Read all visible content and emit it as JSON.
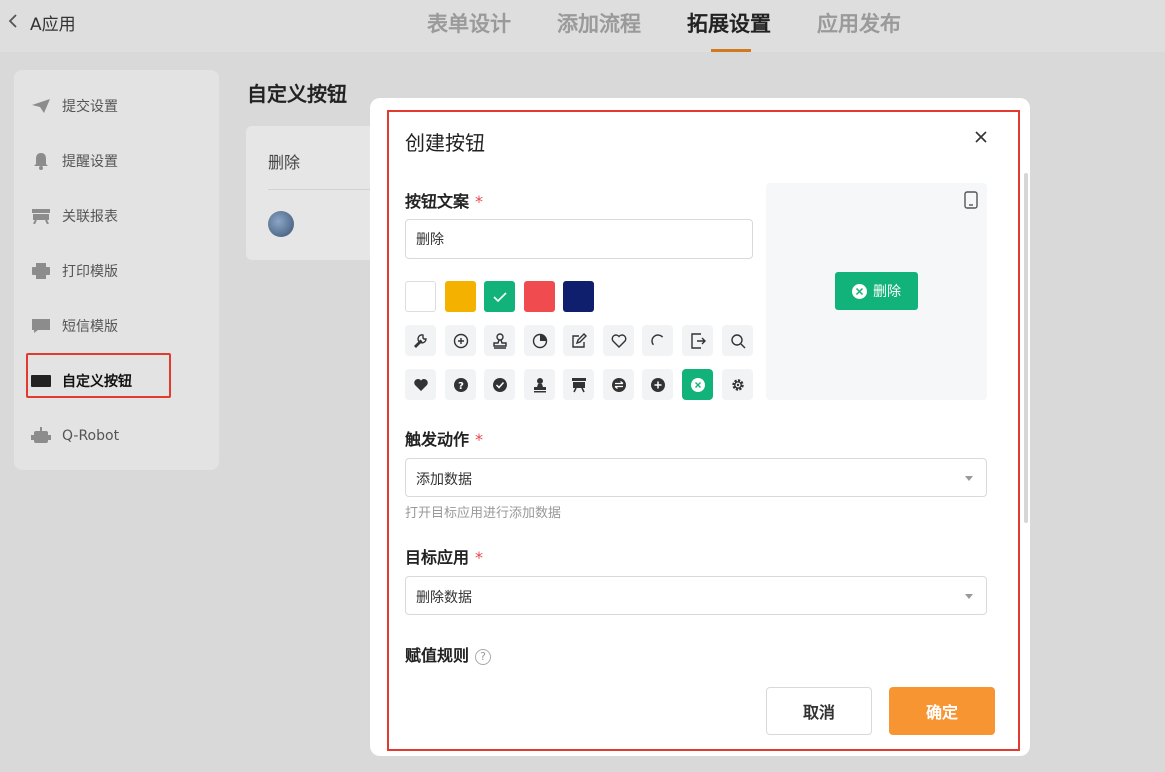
{
  "header": {
    "app_name": "A应用",
    "tabs": [
      {
        "label": "表单设计",
        "active": false
      },
      {
        "label": "添加流程",
        "active": false
      },
      {
        "label": "拓展设置",
        "active": true
      },
      {
        "label": "应用发布",
        "active": false
      }
    ]
  },
  "sidebar": {
    "items": [
      {
        "label": "提交设置",
        "icon": "send-icon"
      },
      {
        "label": "提醒设置",
        "icon": "bell-icon"
      },
      {
        "label": "关联报表",
        "icon": "report-icon"
      },
      {
        "label": "打印模版",
        "icon": "printer-icon"
      },
      {
        "label": "短信模版",
        "icon": "sms-icon"
      },
      {
        "label": "自定义按钮",
        "icon": "button-icon",
        "active": true
      },
      {
        "label": "Q-Robot",
        "icon": "robot-icon"
      }
    ]
  },
  "main": {
    "title": "自定义按钮",
    "card_label": "删除"
  },
  "modal": {
    "title": "创建按钮",
    "button_text_label": "按钮文案",
    "button_text_value": "删除",
    "required_mark": "*",
    "colors": [
      {
        "hex": "#ffffff",
        "selected": false
      },
      {
        "hex": "#f5b100",
        "selected": false
      },
      {
        "hex": "#12b37a",
        "selected": true
      },
      {
        "hex": "#f04b4f",
        "selected": false
      },
      {
        "hex": "#0f1f6e",
        "selected": false
      }
    ],
    "icons_row1": [
      "wrench-icon",
      "plus-circle-icon",
      "stamp-icon",
      "clock-half-icon",
      "edit-square-icon",
      "heart-outline-icon",
      "loading-arc-icon",
      "export-icon",
      "search-icon"
    ],
    "icons_row2": [
      "heart-filled-icon",
      "question-circle-icon",
      "check-circle-icon",
      "stamp-filled-icon",
      "presentation-icon",
      "exchange-circle-icon",
      "plus-circle-filled-icon",
      "close-circle-icon",
      "gear-icon"
    ],
    "selected_icon": "close-circle-icon",
    "preview_label": "删除",
    "trigger_label": "触发动作",
    "trigger_value": "添加数据",
    "trigger_hint": "打开目标应用进行添加数据",
    "target_label": "目标应用",
    "target_value": "删除数据",
    "assign_label": "赋值规则",
    "help_glyph": "?",
    "cancel_label": "取消",
    "ok_label": "确定",
    "accent_color": "#12b37a",
    "primary_color": "#f79532"
  }
}
